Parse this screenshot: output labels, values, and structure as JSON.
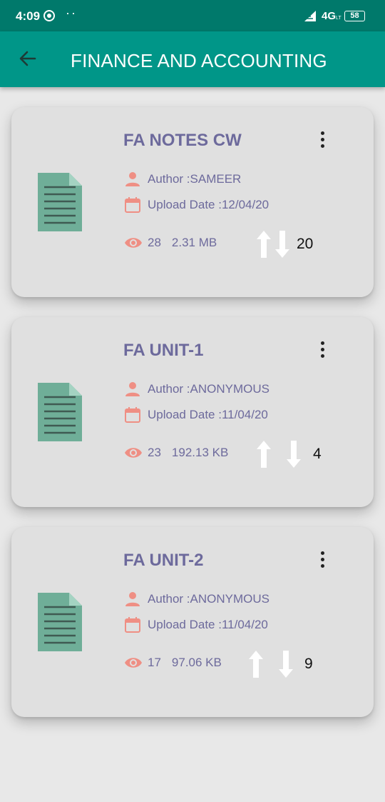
{
  "status_bar": {
    "time": "4:09",
    "dots": "··",
    "network": "4G",
    "network_sub": "LT",
    "battery": "58"
  },
  "app_bar": {
    "title": "FINANCE AND ACCOUNTING"
  },
  "documents": [
    {
      "title": "FA NOTES CW",
      "author": "Author :SAMEER",
      "upload_date": "Upload Date :12/04/20",
      "views": "28",
      "size": "2.31 MB",
      "votes": "20"
    },
    {
      "title": "FA UNIT-1",
      "author": "Author :ANONYMOUS",
      "upload_date": "Upload Date :11/04/20",
      "views": "23",
      "size": "192.13 KB",
      "votes": "4"
    },
    {
      "title": "FA UNIT-2",
      "author": "Author :ANONYMOUS",
      "upload_date": "Upload Date :11/04/20",
      "views": "17",
      "size": "97.06 KB",
      "votes": "9"
    }
  ],
  "colors": {
    "status_bar": "#00796b",
    "app_bar": "#009688",
    "card": "#e0e0e0",
    "text": "#6d6a9c",
    "icon_accent": "#ef8f84",
    "doc_icon": "#6fae98"
  },
  "icons": [
    "back-arrow-icon",
    "document-icon",
    "more-vert-icon",
    "person-icon",
    "calendar-icon",
    "eye-icon",
    "upvote-arrow-icon",
    "downvote-arrow-icon"
  ]
}
